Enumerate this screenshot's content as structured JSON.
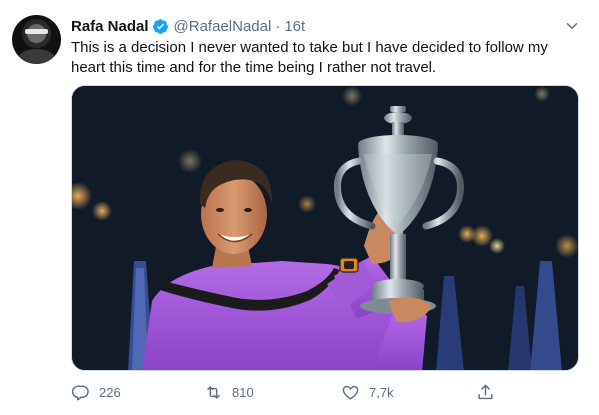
{
  "tweet": {
    "author_name": "Rafa Nadal",
    "handle": "@RafaelNadal",
    "separator": "·",
    "time": "16t",
    "text": "This is a decision I never wanted to take but I have decided to follow my heart this time and for the time being I rather not travel.",
    "verified": true
  },
  "actions": {
    "reply_count": "226",
    "retweet_count": "810",
    "like_count": "7,7k"
  },
  "icons": {
    "verified": "verified-badge-icon",
    "caret": "chevron-down-icon",
    "reply": "speech-bubble-icon",
    "retweet": "retweet-arrows-icon",
    "like": "heart-icon",
    "share": "share-upload-icon"
  },
  "colors": {
    "verified_blue": "#1da1f2",
    "secondary_text": "#5b7083",
    "primary_text": "#0f1419",
    "shirt_purple": "#a25ad8"
  }
}
